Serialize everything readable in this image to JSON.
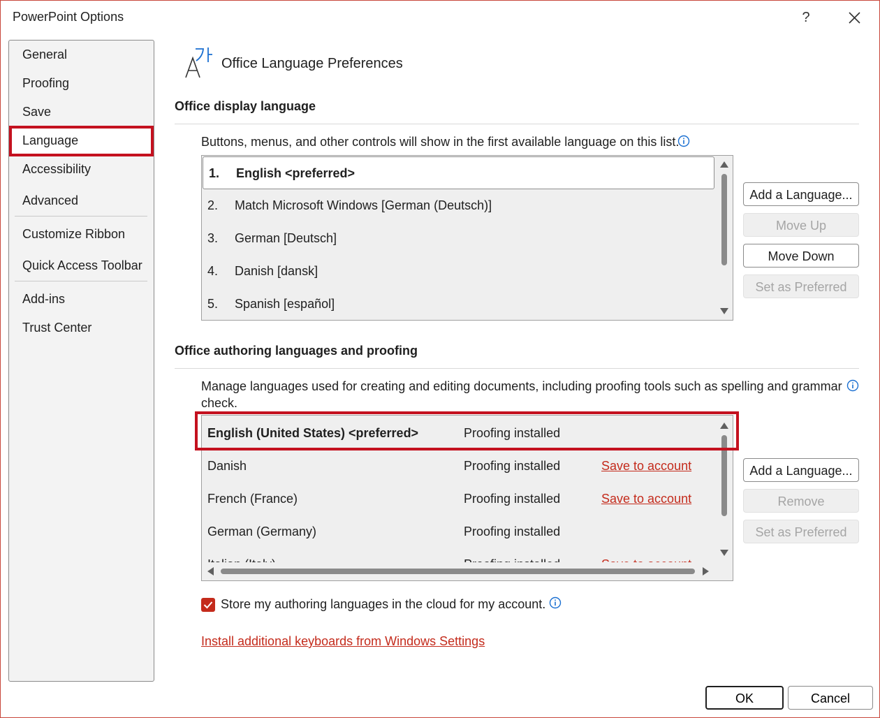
{
  "window": {
    "title": "PowerPoint Options",
    "help_label": "?"
  },
  "sidebar": {
    "items": [
      {
        "label": "General"
      },
      {
        "label": "Proofing"
      },
      {
        "label": "Save"
      },
      {
        "label": "Language"
      },
      {
        "label": "Accessibility"
      },
      {
        "label": "Advanced"
      },
      {
        "label": "Customize Ribbon"
      },
      {
        "label": "Quick Access Toolbar"
      },
      {
        "label": "Add-ins"
      },
      {
        "label": "Trust Center"
      }
    ],
    "selected": "Language"
  },
  "header": {
    "title": "Office Language Preferences"
  },
  "display_language": {
    "section_title": "Office display language",
    "description": "Buttons, menus, and other controls will show in the first available language on this list.",
    "items": [
      {
        "num": "1.",
        "name": "English <preferred>"
      },
      {
        "num": "2.",
        "name": "Match Microsoft Windows [German (Deutsch)]"
      },
      {
        "num": "3.",
        "name": "German [Deutsch]"
      },
      {
        "num": "4.",
        "name": "Danish [dansk]"
      },
      {
        "num": "5.",
        "name": "Spanish [español]"
      }
    ],
    "buttons": {
      "add": "Add a Language...",
      "move_up": "Move Up",
      "move_down": "Move Down",
      "set_preferred": "Set as Preferred"
    }
  },
  "authoring_languages": {
    "section_title": "Office authoring languages and proofing",
    "description_line1": "Manage languages used for creating and editing documents, including proofing tools such as spelling and grammar",
    "description_line2": "check.",
    "items": [
      {
        "name": "English (United States) <preferred>",
        "status": "Proofing installed",
        "action": ""
      },
      {
        "name": "Danish",
        "status": "Proofing installed",
        "action": "Save to account"
      },
      {
        "name": "French (France)",
        "status": "Proofing installed",
        "action": "Save to account"
      },
      {
        "name": "German (Germany)",
        "status": "Proofing installed",
        "action": ""
      },
      {
        "name": "Italian (Italy)",
        "status": "Proofing installed",
        "action": "Save to account"
      }
    ],
    "buttons": {
      "add": "Add a Language...",
      "remove": "Remove",
      "set_preferred": "Set as Preferred"
    },
    "cloud_checkbox": {
      "label": "Store my authoring languages in the cloud for my account.",
      "checked": true
    },
    "keyboards_link": "Install additional keyboards from Windows Settings"
  },
  "footer": {
    "ok": "OK",
    "cancel": "Cancel"
  },
  "colors": {
    "accent": "#c42b1c",
    "highlight": "#c4111f"
  }
}
